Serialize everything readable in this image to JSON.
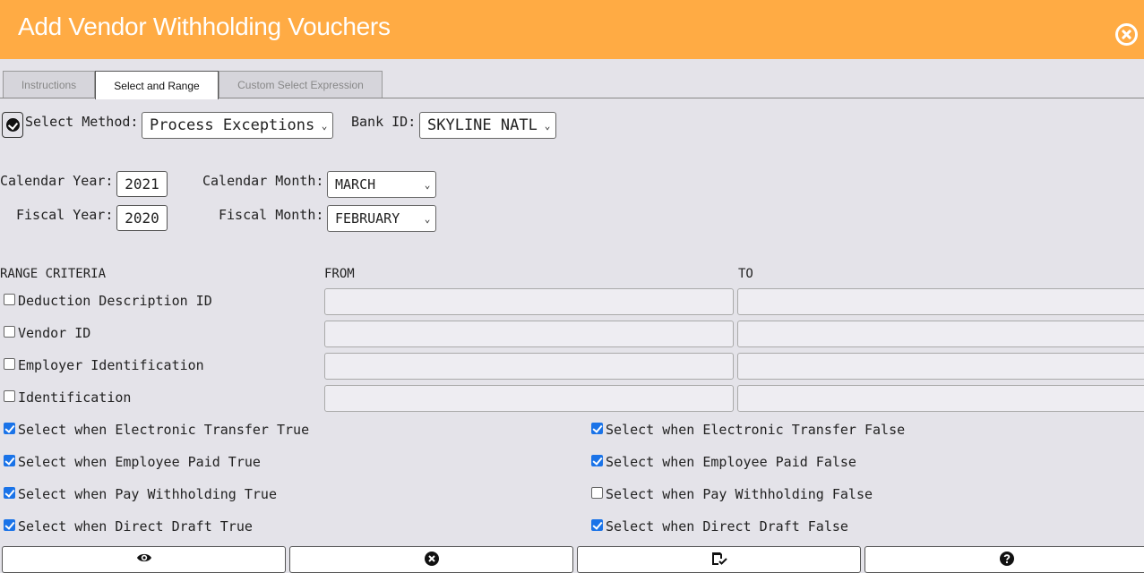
{
  "window": {
    "title": "Add Vendor Withholding Vouchers"
  },
  "tabs": [
    {
      "label": "Instructions"
    },
    {
      "label": "Select and Range"
    },
    {
      "label": "Custom Select Expression"
    }
  ],
  "form": {
    "select_method_label": "Select Method:",
    "select_method_value": "Process Exceptions",
    "bank_id_label": "Bank ID:",
    "bank_id_value": "SKYLINE NATL",
    "calendar_year_label": "Calendar Year:",
    "calendar_year_value": "2021",
    "calendar_month_label": "Calendar Month:",
    "calendar_month_value": "MARCH",
    "fiscal_year_label": "Fiscal Year:",
    "fiscal_year_value": "2020",
    "fiscal_month_label": "Fiscal Month:",
    "fiscal_month_value": "FEBRUARY"
  },
  "range": {
    "header_criteria": "RANGE CRITERIA",
    "header_from": "FROM",
    "header_to": "TO",
    "rows": [
      {
        "label": "Deduction Description ID",
        "checked": false
      },
      {
        "label": "Vendor ID",
        "checked": false
      },
      {
        "label": "Employer Identification",
        "checked": false
      },
      {
        "label": "Identification",
        "checked": false
      }
    ]
  },
  "options": {
    "left": [
      {
        "label": "Select when Electronic Transfer True",
        "checked": true
      },
      {
        "label": "Select when Employee Paid True",
        "checked": true
      },
      {
        "label": "Select when Pay Withholding True",
        "checked": true
      },
      {
        "label": "Select when Direct Draft True",
        "checked": true
      }
    ],
    "right": [
      {
        "label": "Select when Electronic Transfer False",
        "checked": true
      },
      {
        "label": "Select when Employee Paid False",
        "checked": true
      },
      {
        "label": "Select when Pay Withholding False",
        "checked": false
      },
      {
        "label": "Select when Direct Draft False",
        "checked": true
      }
    ]
  },
  "buttons": {
    "icons": [
      "eye-icon",
      "close-circle-icon",
      "save-icon",
      "help-icon"
    ]
  },
  "colors": {
    "header": "#ffab44",
    "background": "#e4e3e9",
    "checkbox": "#1a73e8"
  }
}
